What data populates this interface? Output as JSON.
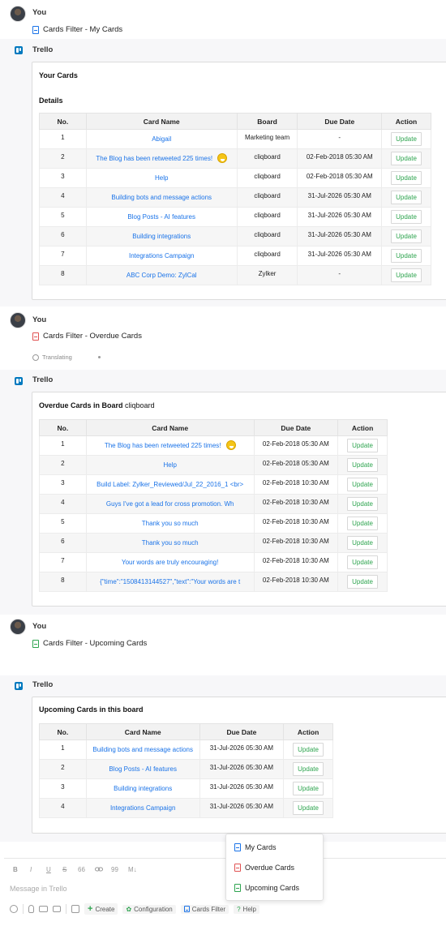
{
  "messages": {
    "you1": {
      "sender": "You",
      "command": "Cards Filter - My Cards"
    },
    "bot1": {
      "sender": "Trello",
      "card_title": "Your Cards",
      "details_label": "Details",
      "columns": [
        "No.",
        "Card Name",
        "Board",
        "Due Date",
        "Action"
      ],
      "rows": [
        {
          "no": "1",
          "name": "Abigail",
          "board": "Marketing team",
          "due": "-",
          "action": "Update"
        },
        {
          "no": "2",
          "name": "The Blog has been retweeted 225 times!",
          "board": "cliqboard",
          "due": "02-Feb-2018 05:30 AM",
          "action": "Update"
        },
        {
          "no": "3",
          "name": "Help",
          "board": "cliqboard",
          "due": "02-Feb-2018 05:30 AM",
          "action": "Update"
        },
        {
          "no": "4",
          "name": "Building bots and message actions",
          "board": "cliqboard",
          "due": "31-Jul-2026 05:30 AM",
          "action": "Update"
        },
        {
          "no": "5",
          "name": "Blog Posts -  AI features",
          "board": "cliqboard",
          "due": "31-Jul-2026 05:30 AM",
          "action": "Update"
        },
        {
          "no": "6",
          "name": "Building integrations",
          "board": "cliqboard",
          "due": "31-Jul-2026 05:30 AM",
          "action": "Update"
        },
        {
          "no": "7",
          "name": "Integrations Campaign",
          "board": "cliqboard",
          "due": "31-Jul-2026 05:30 AM",
          "action": "Update"
        },
        {
          "no": "8",
          "name": "ABC Corp Demo: ZylCal",
          "board": "Zylker",
          "due": "-",
          "action": "Update"
        }
      ]
    },
    "you2": {
      "sender": "You",
      "command": "Cards Filter - Overdue Cards",
      "status": "Translating"
    },
    "bot2": {
      "sender": "Trello",
      "card_title": "Overdue Cards in Board",
      "board_name": "cliqboard",
      "columns": [
        "No.",
        "Card Name",
        "Due Date",
        "Action"
      ],
      "rows": [
        {
          "no": "1",
          "name": "The Blog has been retweeted 225 times!",
          "due": "02-Feb-2018 05:30 AM",
          "action": "Update"
        },
        {
          "no": "2",
          "name": "Help",
          "due": "02-Feb-2018 05:30 AM",
          "action": "Update"
        },
        {
          "no": "3",
          "name": "Build Label: Zylker_Reviewed/Jul_22_2016_1 <br>",
          "due": "02-Feb-2018 10:30 AM",
          "action": "Update"
        },
        {
          "no": "4",
          "name": "Guys I've got a lead for cross promotion. Wh",
          "due": "02-Feb-2018 10:30 AM",
          "action": "Update"
        },
        {
          "no": "5",
          "name": "Thank you so much",
          "due": "02-Feb-2018 10:30 AM",
          "action": "Update"
        },
        {
          "no": "6",
          "name": "Thank you so much",
          "due": "02-Feb-2018 10:30 AM",
          "action": "Update"
        },
        {
          "no": "7",
          "name": "Your words are truly encouraging!",
          "due": "02-Feb-2018 10:30 AM",
          "action": "Update"
        },
        {
          "no": "8",
          "name": "{\"time\":\"1508413144527\",\"text\":\"Your words are t",
          "due": "02-Feb-2018 10:30 AM",
          "action": "Update"
        }
      ]
    },
    "you3": {
      "sender": "You",
      "command": "Cards Filter - Upcoming Cards"
    },
    "bot3": {
      "sender": "Trello",
      "card_title": "Upcoming Cards in this board",
      "columns": [
        "No.",
        "Card Name",
        "Due Date",
        "Action"
      ],
      "rows": [
        {
          "no": "1",
          "name": "Building bots and message actions",
          "due": "31-Jul-2026 05:30 AM",
          "action": "Update"
        },
        {
          "no": "2",
          "name": "Blog Posts -  AI features",
          "due": "31-Jul-2026 05:30 AM",
          "action": "Update"
        },
        {
          "no": "3",
          "name": "Building integrations",
          "due": "31-Jul-2026 05:30 AM",
          "action": "Update"
        },
        {
          "no": "4",
          "name": "Integrations Campaign",
          "due": "31-Jul-2026 05:30 AM",
          "action": "Update"
        }
      ]
    }
  },
  "dropdown": {
    "items": [
      {
        "label": "My Cards",
        "icon": "doc-icon-blue"
      },
      {
        "label": "Overdue Cards",
        "icon": "doc-icon-red"
      },
      {
        "label": "Upcoming Cards",
        "icon": "doc-icon-green"
      }
    ]
  },
  "composer": {
    "format_buttons": [
      "B",
      "I",
      "U",
      "S",
      "66",
      "link",
      "99",
      "M↓"
    ],
    "placeholder": "Message in Trello",
    "actions": {
      "create": "Create",
      "configuration": "Configuration",
      "cards_filter": "Cards Filter",
      "help": "Help"
    }
  },
  "colors": {
    "link": "#1a73e8",
    "update_button_text": "#2ea44f",
    "trello_brand": "#0079bf"
  }
}
